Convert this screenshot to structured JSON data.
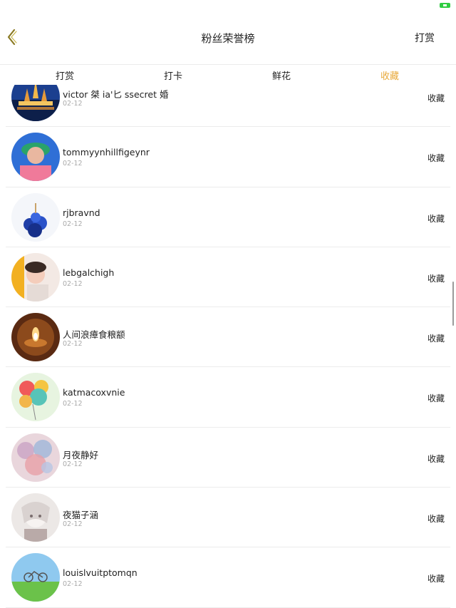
{
  "nav": {
    "title": "粉丝荣誉榜",
    "right_button": "打赏",
    "back_icon": "chevron-left-icon"
  },
  "tabs": [
    {
      "label": "打赏",
      "active": false
    },
    {
      "label": "打卡",
      "active": false
    },
    {
      "label": "鲜花",
      "active": false
    },
    {
      "label": "收藏",
      "active": true
    }
  ],
  "colors": {
    "accent": "#e8a93a",
    "battery": "#2ecc40",
    "back_arrow": "#8a7a24"
  },
  "list": [
    {
      "name": "victor 桀 ia'匕 ssecret 婚",
      "date": "02-12",
      "action": "收藏"
    },
    {
      "name": "tommyynhillfigeynr",
      "date": "02-12",
      "action": "收藏"
    },
    {
      "name": "rjbravnd",
      "date": "02-12",
      "action": "收藏"
    },
    {
      "name": "lebgalchigh",
      "date": "02-12",
      "action": "收藏"
    },
    {
      "name": "人间浪瘴食粮颛",
      "date": "02-12",
      "action": "收藏"
    },
    {
      "name": "katmacoxvnie",
      "date": "02-12",
      "action": "收藏"
    },
    {
      "name": "月夜静好",
      "date": "02-12",
      "action": "收藏"
    },
    {
      "name": "夜猫子涵",
      "date": "02-12",
      "action": "收藏"
    },
    {
      "name": "louislvuitptomqn",
      "date": "02-12",
      "action": "收藏"
    }
  ]
}
